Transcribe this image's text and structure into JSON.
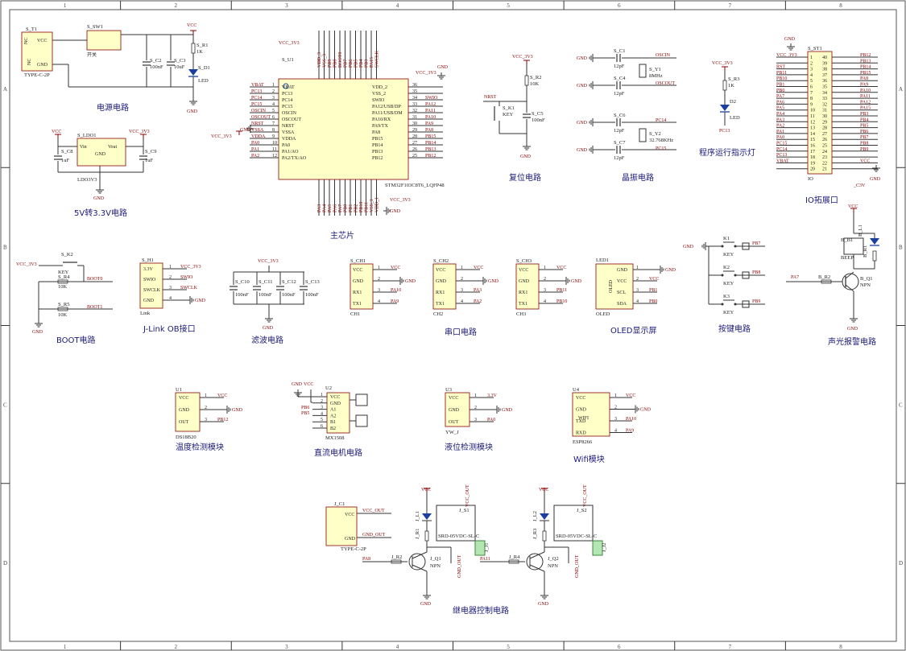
{
  "frame": {
    "cols": [
      "1",
      "2",
      "3",
      "4",
      "5",
      "6",
      "7",
      "8"
    ],
    "rows": [
      "A",
      "B",
      "C",
      "D"
    ]
  },
  "sections": {
    "power": "电源电路",
    "ldo": "5V转3.3V电路",
    "mcu": "主芯片",
    "reset": "复位电路",
    "crystal": "晶振电路",
    "led_ind": "程序运行指示灯",
    "io": "IO拓展口",
    "boot": "BOOT电路",
    "jlink": "J-Link OB接口",
    "filter": "滤波电路",
    "uart": "串口电路",
    "oled": "OLED显示屏",
    "keys": "按键电路",
    "alarm": "声光报警电路",
    "temp": "温度检测模块",
    "motor": "直流电机电路",
    "level": "液位检测模块",
    "wifi": "Wifi模块",
    "relay": "继电器控制电路"
  },
  "power": {
    "conn_ref": "S_T1",
    "conn_type": "TYPE-C-2P",
    "conn_pins": [
      "NC",
      "VCC",
      "GND",
      "NC"
    ],
    "switch_ref": "S_SW1",
    "switch_lbl": "开关",
    "c2": "S_C2",
    "c2v": "100nF",
    "c3": "S_C3",
    "c3v": "10uF",
    "r1": "S_R1",
    "r1v": "1K",
    "d1": "S_D1",
    "d1v": "LED",
    "vcc": "VCC",
    "gnd": "GND"
  },
  "ldo": {
    "ref": "S_LDO1",
    "part": "LDO3V3",
    "vin": "Vin",
    "vout": "Vout",
    "gndpin": "GND",
    "c8": "S_C8",
    "c9": "S_C9",
    "cv": "1uF",
    "vcc": "VCC",
    "vcc33": "VCC_3V3",
    "gnd": "GND"
  },
  "mcu": {
    "ref": "S_U1",
    "part": "STM32F103C8T6_LQFP48",
    "left_pins": [
      "VBAT",
      "PC13",
      "PC14",
      "PC15",
      "OSCIN",
      "OSCOUT",
      "NRST",
      "VSSA",
      "VDDA",
      "PA0",
      "PA1",
      "PA2"
    ],
    "left_nums": [
      "1",
      "2",
      "3",
      "4",
      "5",
      "6",
      "7",
      "8",
      "9",
      "10",
      "11",
      "12"
    ],
    "left_inner": [
      "VBAT",
      "PC13",
      "PC14",
      "PC15",
      "OSCIN",
      "OSCOUT",
      "NRST",
      "VSSA",
      "VDDA",
      "PA0",
      "PA1/AO",
      "PA2/TX/AO"
    ],
    "right_pins": [
      "VDD_2",
      "VSS_2",
      "SWIO",
      "PA12/USB/DP",
      "PA11/USB/DM",
      "PA10/RX",
      "PA9/TX",
      "PA8",
      "PB15",
      "PB14",
      "PB13",
      "PB12"
    ],
    "right_nums": [
      "36",
      "35",
      "34",
      "33",
      "32",
      "31",
      "30",
      "29",
      "28",
      "27",
      "26",
      "25"
    ],
    "right_nets": [
      "",
      "",
      "SWIO",
      "PA12",
      "PA11",
      "PA10",
      "PA9",
      "PA8",
      "PB15",
      "PB14",
      "PB13",
      "PB12"
    ],
    "top_pins": [
      "VDD_3",
      "VSS_3",
      "PB9",
      "PB8",
      "BOOT0",
      "PB7",
      "PB6",
      "PB5",
      "PB4",
      "PB3",
      "PA15",
      "SWCLK"
    ],
    "bottom_pins": [
      "PA3",
      "PA4",
      "PA5",
      "PA6",
      "PA7",
      "PB0",
      "PB1",
      "PB2",
      "PB10",
      "PB11",
      "VSS_1",
      "VDD_1"
    ],
    "vcc33": "VCC_3V3",
    "gnd": "GND"
  },
  "reset": {
    "vcc33": "VCC_3V3",
    "r2": "S_R2",
    "r2v": "10K",
    "k1": "S_K1",
    "key": "KEY",
    "c5": "S_C5",
    "c5v": "100nF",
    "nrst": "NRST",
    "gnd": "GND"
  },
  "crystal": {
    "c1": "S_C1",
    "c4": "S_C4",
    "c6": "S_C6",
    "c7": "S_C7",
    "cv": "12pF",
    "y1": "S_Y1",
    "y1v": "8MHz",
    "y2": "S_Y2",
    "y2v": "32.768KHz",
    "oscin": "OSCIN",
    "oscout": "OSCOUT",
    "pc14": "PC14",
    "pc15": "PC15",
    "gnd": "GND"
  },
  "led_ind": {
    "vcc33": "VCC_3V3",
    "r3": "S_R3",
    "r3v": "1K",
    "d2": "D2",
    "d2v": "LED",
    "pc13": "PC13"
  },
  "io": {
    "ref": "S_ST1",
    "part": "IO",
    "left_nums": [
      "1",
      "2",
      "3",
      "4",
      "5",
      "6",
      "7",
      "8",
      "9",
      "10",
      "11",
      "12",
      "13",
      "14",
      "15",
      "16",
      "17",
      "18",
      "19",
      "20"
    ],
    "right_nums": [
      "40",
      "39",
      "38",
      "37",
      "36",
      "35",
      "34",
      "33",
      "32",
      "31",
      "30",
      "29",
      "28",
      "27",
      "26",
      "25",
      "24",
      "23",
      "22",
      "21"
    ],
    "left_nets": [
      "VCC_3V3",
      "",
      "RST",
      "PB11",
      "PB10",
      "PB1",
      "PB0",
      "PA7",
      "PA6",
      "PA5",
      "PA4",
      "PA3",
      "PA2",
      "PA1",
      "PA0",
      "PC15",
      "PC14",
      "PC13",
      "VBAT",
      ""
    ],
    "right_nets": [
      "PB12",
      "PB13",
      "PB14",
      "PB15",
      "PA8",
      "PA9",
      "PA10",
      "PA11",
      "PA12",
      "PA15",
      "PB3",
      "PB4",
      "PB5",
      "PB6",
      "PB7",
      "PB8",
      "PB9",
      "",
      "VCC",
      ""
    ],
    "gnd": "GND",
    "c3v": "_C3V"
  },
  "boot": {
    "vcc33": "VCC_3V3",
    "k2": "S_K2",
    "key": "KEY",
    "r4": "S_R4",
    "r5": "S_R5",
    "rv": "10K",
    "boot0": "BOOT0",
    "boot1": "BOOT1",
    "gnd": "GND"
  },
  "jlink": {
    "ref": "S_H1",
    "part": "Link",
    "pins": [
      "3.3V",
      "SWIO",
      "SWCLK",
      "GND"
    ],
    "nets": [
      "VCC_3V3",
      "SWIO",
      "SWCLK",
      "GND"
    ]
  },
  "filter": {
    "vcc33": "VCC_3V3",
    "caps": [
      "S_C10",
      "S_C11",
      "S_C12",
      "S_C13"
    ],
    "cv": "100nF",
    "gnd": "GND"
  },
  "uart": {
    "modules": [
      {
        "ref": "S_CH1",
        "part": "CH1",
        "rx": "PA10",
        "tx": "PA9"
      },
      {
        "ref": "S_CH2",
        "part": "CH2",
        "rx": "PA3",
        "tx": "PA2"
      },
      {
        "ref": "S_CH3",
        "part": "CH3",
        "rx": "PB11",
        "tx": "PB10"
      }
    ],
    "pins": [
      "VCC",
      "GND",
      "RX1",
      "TX1"
    ],
    "vcc": "VCC",
    "gnd": "GND"
  },
  "oled": {
    "ref": "LED1",
    "part": "OLED",
    "body": "OLED",
    "pins": [
      "GND",
      "VCC",
      "SCL",
      "SDA"
    ],
    "nets": [
      "GND",
      "VCC",
      "PB1",
      "PB0"
    ]
  },
  "keys": {
    "refs": [
      "K1",
      "K2",
      "K3"
    ],
    "key": "KEY",
    "nets": [
      "PB7",
      "PB8",
      "PB9"
    ],
    "gnd": "GND"
  },
  "alarm": {
    "vcc": "VCC",
    "b1": "B_B1",
    "beep": "BEEP",
    "l1": "B_L1",
    "r1": "B_R1",
    "r2": "B_R2",
    "q1": "B_Q1",
    "npn": "NPN",
    "pa7": "PA7",
    "gnd": "GND"
  },
  "temp": {
    "ref": "U1",
    "part": "DS18B20",
    "pins": [
      "VCC",
      "GND",
      "OUT"
    ],
    "nets": [
      "VCC",
      "GND",
      "PB12"
    ]
  },
  "motor": {
    "ref": "U2",
    "part": "MX1508",
    "pins": [
      "VCC",
      "GND",
      "A1",
      "A2",
      "B1",
      "B2"
    ],
    "nets": [
      "PB6",
      "PB5"
    ],
    "gnd": "GND",
    "vcc": "VCC"
  },
  "level": {
    "ref": "U3",
    "part": "YW_J",
    "pins": [
      "VCC",
      "GND",
      "OUT"
    ],
    "nets": [
      "3.3V",
      "GND",
      "PA0"
    ]
  },
  "wifi": {
    "ref": "U4",
    "part": "ESP8266",
    "body": "WIFI",
    "pins": [
      "VCC",
      "GND",
      "TXD",
      "RXD"
    ],
    "nets": [
      "VCC",
      "GND",
      "PA10",
      "PA9"
    ]
  },
  "relay": {
    "conn_ref": "J_C1",
    "conn_type": "TYPE-C-2P",
    "conn_pins": [
      "NC",
      "VCC",
      "GND",
      "NC"
    ],
    "vcc_out": "VCC_OUT",
    "gnd_out": "GND_OUT",
    "vcc": "VCC",
    "gnd": "GND",
    "npn": "NPN",
    "ch": [
      {
        "l": "J_L1",
        "r1": "J_R1",
        "r2": "J_R2",
        "q": "J_Q1",
        "s": "J_S1",
        "j": "J_J1",
        "ctrl": "PA8",
        "relay": "SRD-05VDC-SL-C"
      },
      {
        "l": "J_L2",
        "r1": "J_R3",
        "r2": "J_R4",
        "q": "J_Q2",
        "s": "J_S2",
        "j": "J_J2",
        "ctrl": "PA11",
        "relay": "SRD-05VDC-SL-C"
      }
    ]
  }
}
